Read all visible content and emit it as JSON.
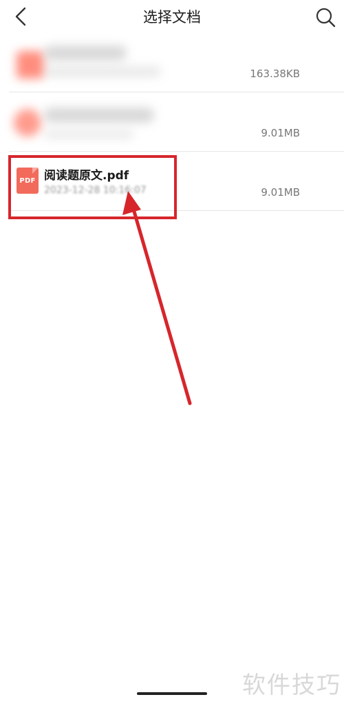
{
  "header": {
    "title": "选择文档",
    "back_icon": "chevron-left-icon",
    "search_icon": "search-icon"
  },
  "files": [
    {
      "name": "",
      "date": "",
      "size": "163.38KB",
      "obscured": true
    },
    {
      "name": "",
      "date": "",
      "size": "9.01MB",
      "obscured": true
    },
    {
      "name": "阅读题原文.pdf",
      "date": "2023-12-28 10:16:07",
      "size": "9.01MB",
      "obscured": false,
      "icon_label": "PDF"
    }
  ],
  "watermark": "软件技巧",
  "colors": {
    "accent_red": "#d6262c",
    "pdf_icon": "#f26a5b"
  }
}
